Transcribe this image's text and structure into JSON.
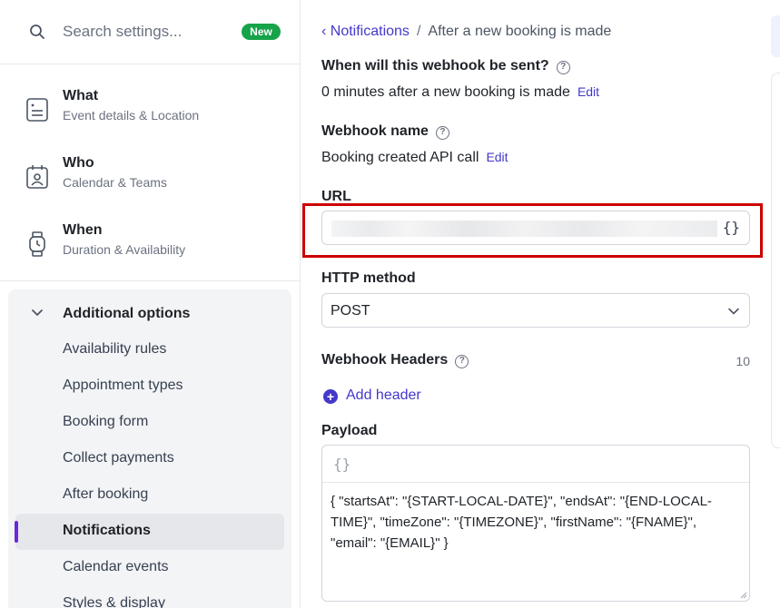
{
  "search": {
    "placeholder": "Search settings...",
    "badge": "New"
  },
  "nav": [
    {
      "title": "What",
      "subtitle": "Event details & Location",
      "icon": "document-icon"
    },
    {
      "title": "Who",
      "subtitle": "Calendar & Teams",
      "icon": "calendar-user-icon"
    },
    {
      "title": "When",
      "subtitle": "Duration & Availability",
      "icon": "watch-icon"
    }
  ],
  "additional": {
    "label": "Additional options",
    "items": [
      "Availability rules",
      "Appointment types",
      "Booking form",
      "Collect payments",
      "After booking",
      "Notifications",
      "Calendar events",
      "Styles & display"
    ],
    "active": "Notifications"
  },
  "breadcrumb": {
    "back": "Notifications",
    "separator": "/",
    "current": "After a new booking is made"
  },
  "when_sent": {
    "label": "When will this webhook be sent?",
    "value": "0 minutes after a new booking is made",
    "edit": "Edit"
  },
  "webhook_name": {
    "label": "Webhook name",
    "value": "Booking created API call",
    "edit": "Edit"
  },
  "url": {
    "label": "URL",
    "braces": "{}"
  },
  "http_method": {
    "label": "HTTP method",
    "value": "POST"
  },
  "headers": {
    "label": "Webhook Headers",
    "count": "10",
    "add": "Add header"
  },
  "payload": {
    "label": "Payload",
    "braces": "{}",
    "body": "{ \"startsAt\": \"{START-LOCAL-DATE}\", \"endsAt\": \"{END-LOCAL-TIME}\", \"timeZone\": \"{TIMEZONE}\", \"firstName\": \"{FNAME}\", \"email\": \"{EMAIL}\" }"
  },
  "colors": {
    "accent": "#4338ca",
    "active_bar": "#6d28d9",
    "badge": "#16a34a",
    "highlight": "#cc0000"
  }
}
